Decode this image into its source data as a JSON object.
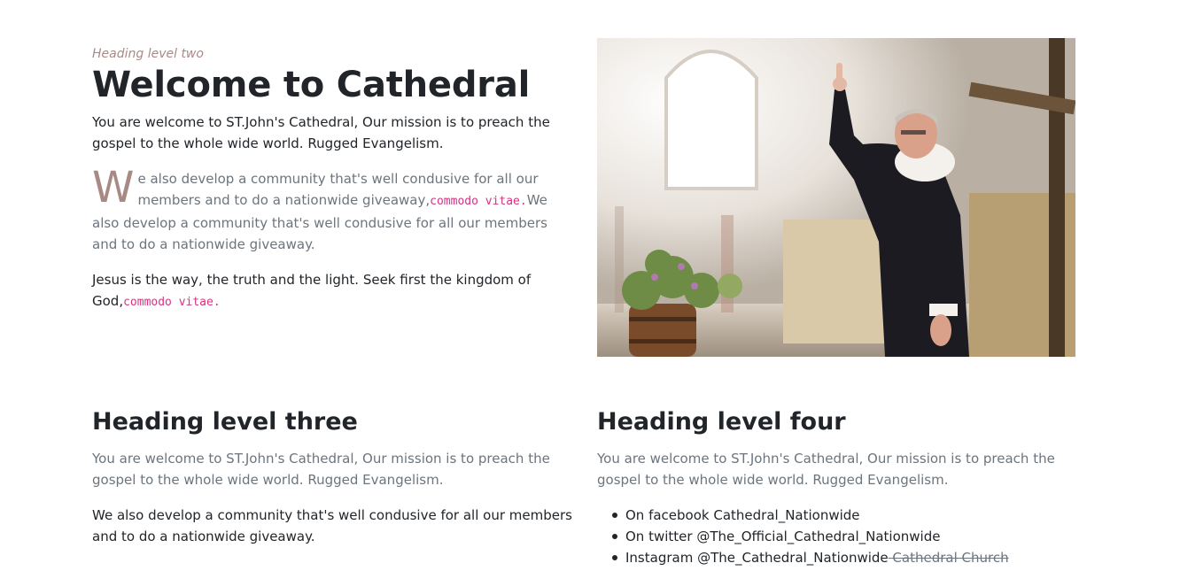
{
  "hero": {
    "eyebrow": "Heading level two",
    "title": "Welcome to Cathedral",
    "lead": "You are welcome to ST.John's Cathedral, Our mission is to preach the gospel to the whole wide world. Rugged Evangelism.",
    "dropcap_letter": "W",
    "para2_text": "e also develop a community that's well condusive for all our members and to do a nationwide giveaway,",
    "para2_code": "commodo vitae.",
    "para2_tail": "We also develop a community that's well condusive for all our members and to do a nationwide giveaway.",
    "para3_text": "Jesus is the way, the truth and the light. Seek first the kingdom of God,",
    "para3_code": "commodo vitae."
  },
  "image": {
    "alt": "Priest blessing in a rustic hall"
  },
  "section3": {
    "heading": "Heading level three",
    "p1": "You are welcome to ST.John's Cathedral, Our mission is to preach the gospel to the whole wide world. Rugged Evangelism.",
    "p2": "We also develop a community that's well condusive for all our members and to do a nationwide giveaway."
  },
  "section4": {
    "heading": "Heading level four",
    "p1": "You are welcome to ST.John's Cathedral, Our mission is to preach the gospel to the whole wide world. Rugged Evangelism.",
    "list": [
      {
        "text": "On facebook Cathedral_Nationwide"
      },
      {
        "text": "On twitter @The_Official_Cathedral_Nationwide"
      },
      {
        "text": "Instagram @The_Cathedral_Nationwide",
        "strike": " Cathedral Church"
      }
    ]
  },
  "colors": {
    "accent": "#a88a85",
    "code": "#d63384",
    "muted": "#6c757d",
    "text": "#212529"
  }
}
